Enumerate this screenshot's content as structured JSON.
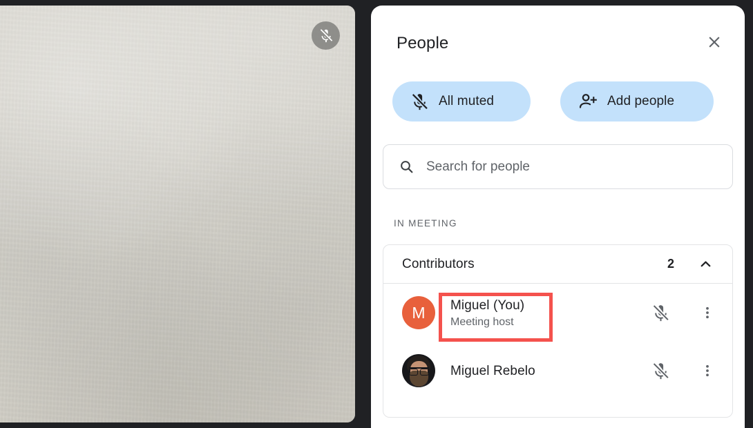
{
  "video_tile": {
    "name": "self-video-tile",
    "mute_badge_icon": "mic-off-icon",
    "mute_badge_label": "Microphone muted"
  },
  "panel": {
    "title": "People",
    "close_icon": "close-icon",
    "actions": [
      {
        "id": "all-muted",
        "label": "All muted",
        "icon": "mic-off-icon"
      },
      {
        "id": "add-people",
        "label": "Add people",
        "icon": "person-add-icon"
      }
    ],
    "search": {
      "placeholder": "Search for people",
      "value": "",
      "icon": "search-icon"
    },
    "section_label": "IN MEETING",
    "group": {
      "name": "Contributors",
      "count": "2",
      "expanded": true,
      "chevron_icon": "chevron-up-icon",
      "people": [
        {
          "name": "Miguel (You)",
          "subtitle": "Meeting host",
          "avatar_type": "initial",
          "avatar_initial": "M",
          "avatar_color": "#e8603c",
          "mic_icon": "mic-off-icon",
          "more_icon": "more-vert-icon",
          "highlighted": true
        },
        {
          "name": "Miguel Rebelo",
          "subtitle": "",
          "avatar_type": "photo",
          "avatar_initial": "",
          "avatar_color": "#17171a",
          "mic_icon": "mic-off-icon",
          "more_icon": "more-vert-icon",
          "highlighted": false
        }
      ]
    }
  },
  "colors": {
    "panel_bg": "#ffffff",
    "app_bg": "#202124",
    "pill_bg": "#c3e1fb",
    "accent_highlight": "#f4524d",
    "text_primary": "#202124",
    "text_secondary": "#5f6368",
    "avatar_orange": "#e8603c"
  }
}
